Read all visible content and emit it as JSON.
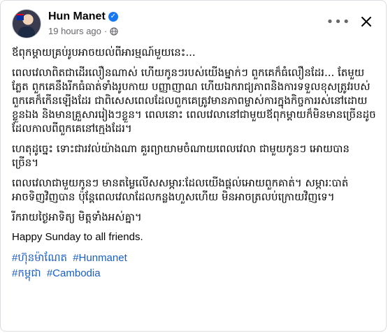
{
  "post": {
    "author": "Hun Manet",
    "time": "19 hours ago",
    "meta_separator": "·",
    "paragraphs": [
      "ឪពុកម្តាយគ្រប់រូបអាចយល់ពីអារម្មណ៍មួយនេះ...",
      "ពេលវេលាពិតជាដើរលឿនណាស់ ហើយកូនៗរបស់យើងម្នាក់ៗ ពួកគេក៏ធំលឿនដែរ... តែមួយភ្លែត ពួកគេនឹងរីកធំធាត់ទាំងរូបកាយ បញ្ញាញាណ ហើយឯករាជ្យភាពនិងការទទួលខុសត្រូវរបស់ពួកគេក៏កើនឡើងដែរ ជាពិសេសពេលដែលពួកគេត្រូវមានភាពម្ចាស់ការក្នុងកិច្ចការរស់នៅដោយខ្លួនឯង និងមានគ្រួសាររៀងៗខ្លួន។ ពេលនោះ ពេលវេលានៅជាមួយឪពុកម្តាយក៏មិនមានច្រើនដូចដែលកាលពីពួកគេនៅក្មេងដែរ។",
      "ហេតុដូច្នេះ ទោះជារវល់យ៉ាងណា គួរព្យាយាមចំណាយពេលវេលា ជាមួយកូនៗ អោយបានច្រើន។",
      "ពេលវេលាជាមួយកូនៗ មានតម្លៃលើសសម្ភារៈដែលយើងផ្តល់អោយពួកគាត់។ សម្ភារៈបាត់អាចទិញវិញបាន ប៉ុន្តែពេលវេលាដែលកន្លងហួសហើយ មិនអាចត្រលប់ក្រោយវិញទេ។",
      "រីករាយថ្ងៃអាទិត្យ មិត្តទាំងអស់គ្នា។"
    ],
    "english_line": "Happy Sunday to all friends.",
    "hashtags": [
      [
        "#ហ៊ុនម៉ាណែត",
        "#Hunmanet"
      ],
      [
        "#កម្ពុជា",
        "#Cambodia"
      ]
    ]
  },
  "icons": {
    "verified": "verified-badge-icon",
    "globe": "globe-icon",
    "more": "more-options-icon",
    "close": "close-icon"
  },
  "colors": {
    "link": "#1a5ec4",
    "verified": "#1877f2",
    "secondary_text": "#65676b"
  }
}
